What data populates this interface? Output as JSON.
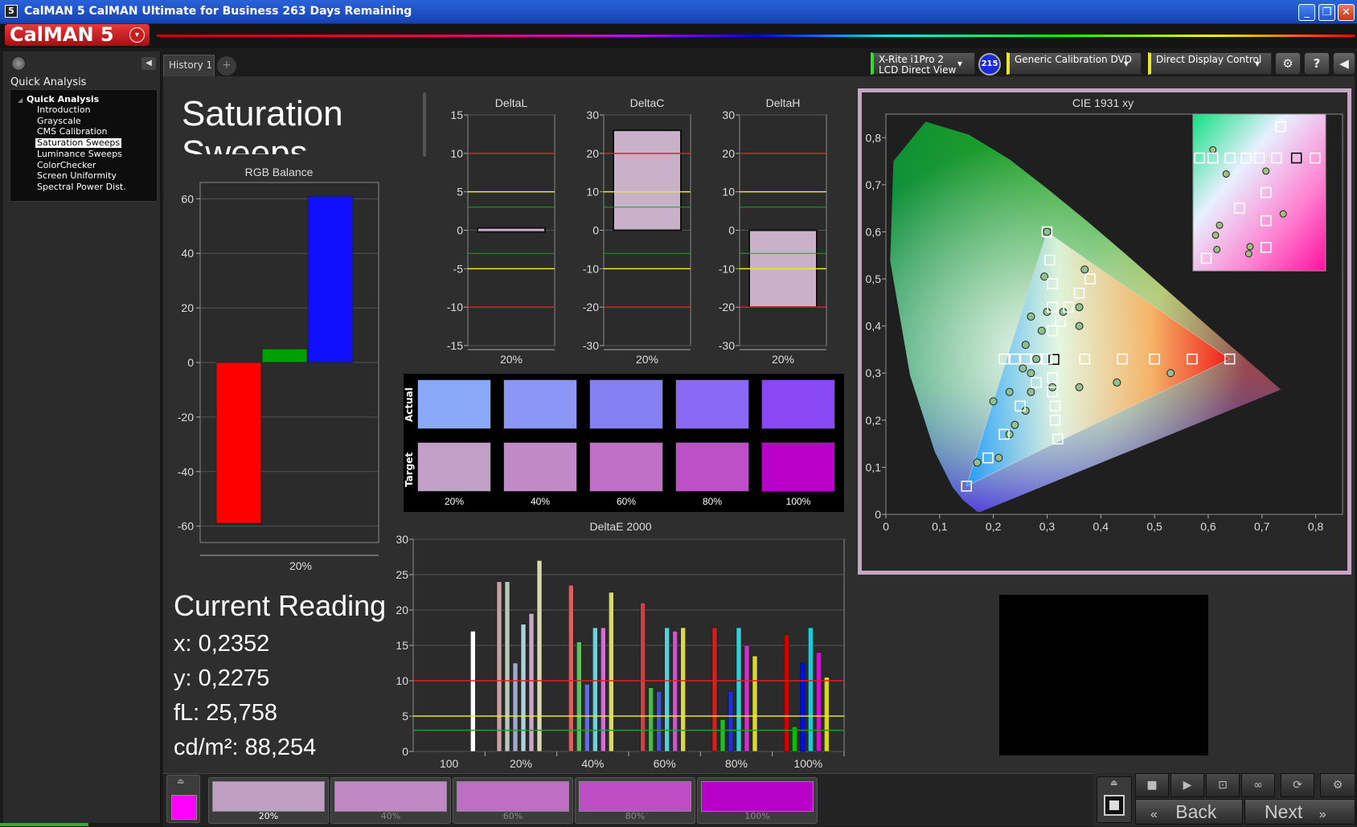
{
  "window": {
    "title": "CalMAN 5 CalMAN Ultimate for Business 263 Days Remaining",
    "app_icon": "5",
    "minimize": "_",
    "restore": "❐",
    "close": "✕"
  },
  "app": {
    "logo": "CalMAN 5",
    "logo_dropdown": "▾"
  },
  "tabs": {
    "history": "History 1",
    "add": "+"
  },
  "toolbar": {
    "meter_line1": "X-Rite i1Pro 2",
    "meter_line2": "LCD Direct View",
    "meter_badge": "215",
    "source": "Generic Calibration DVD",
    "display": "Direct Display Control",
    "settings_icon": "gear-icon",
    "help": "?",
    "collapse": "◀"
  },
  "sidebar": {
    "title": "Quick Analysis",
    "tree_root": "Quick Analysis",
    "items": [
      "Introduction",
      "Grayscale",
      "CMS Calibration",
      "Saturation Sweeps",
      "Luminance Sweeps",
      "ColorChecker",
      "Screen Uniformity",
      "Spectral Power Dist."
    ],
    "selected_index": 3
  },
  "page": {
    "title": "Saturation",
    "title_line2": "Sweeps"
  },
  "reading": {
    "heading": "Current Reading",
    "x": "x: 0,2352",
    "y": "y: 0,2275",
    "fl": "fL: 25,758",
    "cdm2": "cd/m²: 88,254"
  },
  "chart_data": [
    {
      "id": "rgb-balance",
      "type": "bar",
      "title": "RGB Balance",
      "categories": [
        "20%"
      ],
      "series": [
        {
          "color": "#ff0000",
          "values": [
            -59
          ]
        },
        {
          "color": "#00a000",
          "values": [
            5
          ]
        },
        {
          "color": "#1010ff",
          "values": [
            61
          ]
        }
      ],
      "yticks": [
        "60",
        "40",
        "20",
        "0",
        "-20",
        "-40",
        "-60"
      ],
      "ylim": [
        -66,
        66
      ]
    },
    {
      "id": "delta-l",
      "type": "bar",
      "title": "DeltaL",
      "categories": [
        "20%"
      ],
      "values": [
        0.3
      ],
      "yticks": [
        "15",
        "10",
        "5",
        "0",
        "-5",
        "-10",
        "-15"
      ],
      "ylim": [
        -15,
        15
      ]
    },
    {
      "id": "delta-c",
      "type": "bar",
      "title": "DeltaC",
      "categories": [
        "20%"
      ],
      "values": [
        26
      ],
      "yticks": [
        "30",
        "20",
        "10",
        "0",
        "-10",
        "-20",
        "-30"
      ],
      "ylim": [
        -30,
        30
      ]
    },
    {
      "id": "delta-h",
      "type": "bar",
      "title": "DeltaH",
      "categories": [
        "20%"
      ],
      "values": [
        -20
      ],
      "yticks": [
        "30",
        "20",
        "10",
        "0",
        "-10",
        "-20",
        "-30"
      ],
      "ylim": [
        -30,
        30
      ]
    },
    {
      "id": "deltae-2000",
      "type": "bar",
      "title": "DeltaE 2000",
      "categories": [
        "100",
        "20%",
        "40%",
        "60%",
        "80%",
        "100%"
      ],
      "groups": [
        [
          17
        ],
        [
          24,
          24,
          12.5,
          18,
          19.5,
          27
        ],
        [
          23.5,
          15.5,
          9.5,
          17.5,
          17.5,
          22.5
        ],
        [
          21,
          9,
          8.5,
          17.5,
          17,
          17.5
        ],
        [
          17.5,
          4.5,
          8.5,
          17.5,
          15,
          13.5
        ],
        [
          16.5,
          3.5,
          12.5,
          17.5,
          14,
          10.5
        ]
      ],
      "yticks": [
        "30",
        "25",
        "20",
        "15",
        "10",
        "5",
        "0"
      ],
      "ylim": [
        0,
        30
      ]
    },
    {
      "id": "cie-1931",
      "type": "scatter",
      "title": "CIE 1931 xy",
      "xticks": [
        "0",
        "0,1",
        "0,2",
        "0,3",
        "0,4",
        "0,5",
        "0,6",
        "0,7",
        "0,8"
      ],
      "yticks": [
        "0",
        "0,1",
        "0,2",
        "0,3",
        "0,4",
        "0,5",
        "0,6",
        "0,7",
        "0,8"
      ],
      "xlim": [
        0,
        0.85
      ],
      "ylim": [
        0,
        0.85
      ],
      "gamut": [
        [
          0.64,
          0.33
        ],
        [
          0.3,
          0.6
        ],
        [
          0.15,
          0.06
        ]
      ],
      "targets": [
        [
          0.3127,
          0.329
        ],
        [
          0.37,
          0.33
        ],
        [
          0.44,
          0.33
        ],
        [
          0.5,
          0.33
        ],
        [
          0.57,
          0.33
        ],
        [
          0.64,
          0.33
        ],
        [
          0.3,
          0.6
        ],
        [
          0.305,
          0.54
        ],
        [
          0.31,
          0.49
        ],
        [
          0.31,
          0.44
        ],
        [
          0.31,
          0.39
        ],
        [
          0.325,
          0.41
        ],
        [
          0.34,
          0.44
        ],
        [
          0.36,
          0.47
        ],
        [
          0.38,
          0.5
        ],
        [
          0.3,
          0.33
        ],
        [
          0.28,
          0.33
        ],
        [
          0.26,
          0.33
        ],
        [
          0.24,
          0.33
        ],
        [
          0.22,
          0.33
        ],
        [
          0.28,
          0.28
        ],
        [
          0.25,
          0.23
        ],
        [
          0.22,
          0.17
        ],
        [
          0.19,
          0.12
        ],
        [
          0.15,
          0.06
        ],
        [
          0.31,
          0.29
        ],
        [
          0.31,
          0.26
        ],
        [
          0.315,
          0.23
        ],
        [
          0.315,
          0.2
        ],
        [
          0.32,
          0.16
        ]
      ],
      "measured": [
        [
          0.3,
          0.6
        ],
        [
          0.295,
          0.505
        ],
        [
          0.27,
          0.42
        ],
        [
          0.26,
          0.36
        ],
        [
          0.255,
          0.31
        ],
        [
          0.23,
          0.26
        ],
        [
          0.2,
          0.24
        ],
        [
          0.17,
          0.11
        ],
        [
          0.3,
          0.43
        ],
        [
          0.29,
          0.39
        ],
        [
          0.28,
          0.33
        ],
        [
          0.27,
          0.3
        ],
        [
          0.27,
          0.26
        ],
        [
          0.26,
          0.22
        ],
        [
          0.24,
          0.19
        ],
        [
          0.33,
          0.43
        ],
        [
          0.37,
          0.52
        ],
        [
          0.36,
          0.44
        ],
        [
          0.36,
          0.4
        ],
        [
          0.31,
          0.27
        ],
        [
          0.36,
          0.27
        ],
        [
          0.43,
          0.28
        ],
        [
          0.53,
          0.3
        ],
        [
          0.23,
          0.17
        ],
        [
          0.21,
          0.12
        ]
      ]
    }
  ],
  "patches": {
    "actual_label": "Actual",
    "target_label": "Target",
    "labels": [
      "20%",
      "40%",
      "60%",
      "80%",
      "100%"
    ],
    "actual_colors": [
      "#8aa8f8",
      "#8b96f5",
      "#8680f5",
      "#8a6af5",
      "#8948f4"
    ],
    "target_colors": [
      "#c0a0c4",
      "#c08ac6",
      "#c070c6",
      "#bd50c6",
      "#b800c8"
    ]
  },
  "bottom": {
    "current_swatch_color": "#ff00ff",
    "swatches": [
      {
        "label": "20%",
        "color": "#bfa0c3"
      },
      {
        "label": "40%",
        "color": "#c088c4"
      },
      {
        "label": "60%",
        "color": "#be6fc4"
      },
      {
        "label": "80%",
        "color": "#bd4ec6"
      },
      {
        "label": "100%",
        "color": "#b700c8"
      }
    ],
    "back": "Back",
    "next": "Next"
  }
}
